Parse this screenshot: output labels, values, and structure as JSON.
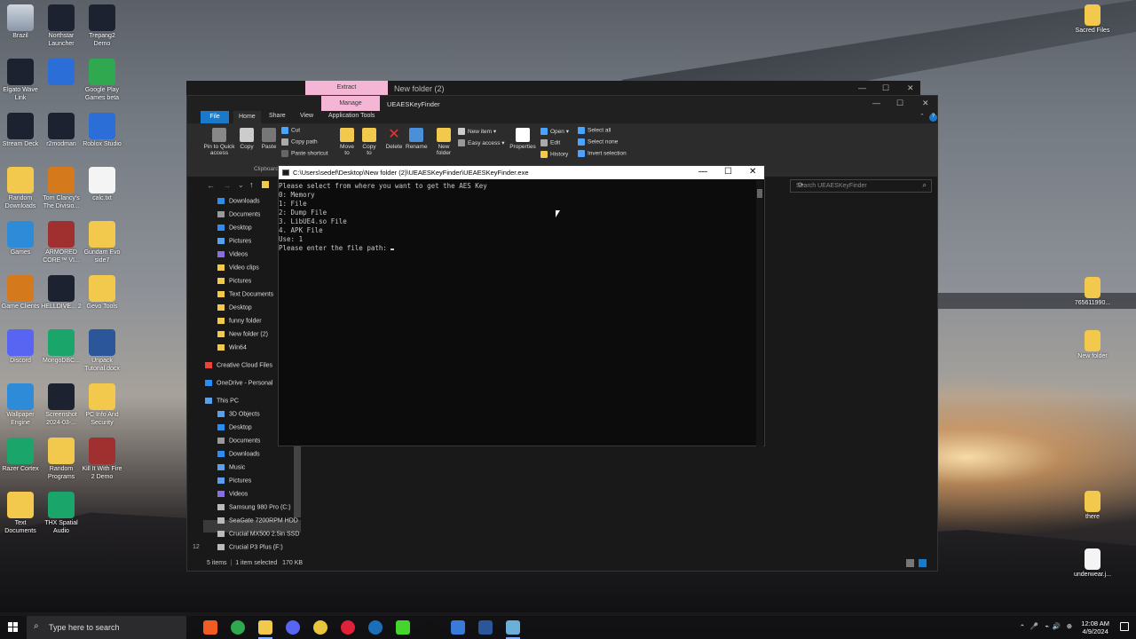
{
  "desktop": {
    "icons_left": [
      {
        "label": "Brazil",
        "icon": "recycle-bin-icon"
      },
      {
        "label": "Northstar Launcher",
        "icon": "northstar-icon"
      },
      {
        "label": "Trepang2 Demo",
        "icon": "trepang-icon"
      },
      {
        "label": "Elgato Wave Link",
        "icon": "wave-link-icon"
      },
      {
        "label": "",
        "icon": "app-icon"
      },
      {
        "label": "Google Play Games beta",
        "icon": "play-games-icon"
      },
      {
        "label": "Stream Deck",
        "icon": "stream-deck-icon"
      },
      {
        "label": "r2modman",
        "icon": "r2modman-icon"
      },
      {
        "label": "Roblox Studio",
        "icon": "roblox-icon"
      },
      {
        "label": "Random Downloads",
        "icon": "folder-icon"
      },
      {
        "label": "Tom Clancy's The Divisio...",
        "icon": "division-icon"
      },
      {
        "label": "calc.txt",
        "icon": "text-file-icon"
      },
      {
        "label": "Games",
        "icon": "games-icon"
      },
      {
        "label": "ARMORED CORE™ VI...",
        "icon": "armored-core-icon"
      },
      {
        "label": "Gundam Evo side7",
        "icon": "folder-icon"
      },
      {
        "label": "Game Clients",
        "icon": "game-clients-icon"
      },
      {
        "label": "HELLDIVE... 2",
        "icon": "helldivers-icon"
      },
      {
        "label": "Gevo Tools",
        "icon": "folder-icon"
      },
      {
        "label": "Discord",
        "icon": "discord-icon"
      },
      {
        "label": "MongoDBC...",
        "icon": "mongodb-icon"
      },
      {
        "label": "Unpack Tutorial.docx",
        "icon": "word-doc-icon"
      },
      {
        "label": "Wallpaper Engine",
        "icon": "wallpaper-engine-icon"
      },
      {
        "label": "Screenshot 2024-03-...",
        "icon": "screenshot-icon"
      },
      {
        "label": "PC Info And Security",
        "icon": "folder-icon"
      },
      {
        "label": "Razer Cortex",
        "icon": "razer-cortex-icon"
      },
      {
        "label": "Random Programs",
        "icon": "folder-icon"
      },
      {
        "label": "Kill It With Fire 2 Demo",
        "icon": "kill-it-with-fire-icon"
      },
      {
        "label": "Text Documents",
        "icon": "folder-icon"
      },
      {
        "label": "THX Spatial Audio",
        "icon": "thx-icon"
      }
    ],
    "icons_right": [
      {
        "label": "Sacred Files",
        "icon": "folder-icon"
      },
      {
        "label": "765611990...",
        "icon": "folder-icon"
      },
      {
        "label": "New folder",
        "icon": "folder-icon"
      },
      {
        "label": "there",
        "icon": "folder-icon"
      },
      {
        "label": "underwear.j...",
        "icon": "image-file-icon"
      }
    ]
  },
  "explorer_back": {
    "context_tab": "Extract",
    "title": "New folder (2)"
  },
  "explorer": {
    "context_tab": "Manage",
    "title": "UEAESKeyFinder",
    "tabs": [
      "File",
      "Home",
      "Share",
      "View",
      "Application Tools"
    ],
    "ribbon": {
      "pin_label": "Pin to Quick access",
      "copy_label": "Copy",
      "paste_label": "Paste",
      "cut_label": "Cut",
      "copy_path_label": "Copy path",
      "paste_shortcut_label": "Paste shortcut",
      "clipboard_group": "Clipboard",
      "move_to_label": "Move to",
      "copy_to_label": "Copy to",
      "delete_label": "Delete",
      "rename_label": "Rename",
      "new_folder_label": "New folder",
      "new_item_label": "New item",
      "easy_access_label": "Easy access",
      "properties_label": "Properties",
      "open_label": "Open",
      "edit_label": "Edit",
      "history_label": "History",
      "select_all_label": "Select all",
      "select_none_label": "Select none",
      "invert_selection_label": "Invert selection"
    },
    "search_placeholder": "Search UEAESKeyFinder",
    "nav_items": [
      {
        "label": "Downloads",
        "icon": "download-icon"
      },
      {
        "label": "Documents",
        "icon": "documents-icon"
      },
      {
        "label": "Desktop",
        "icon": "desktop-icon"
      },
      {
        "label": "Pictures",
        "icon": "pictures-icon"
      },
      {
        "label": "Videos",
        "icon": "videos-icon"
      },
      {
        "label": "Video clips",
        "icon": "folder-icon"
      },
      {
        "label": "Pictures",
        "icon": "folder-icon"
      },
      {
        "label": "Text Documents",
        "icon": "folder-icon"
      },
      {
        "label": "Desktop",
        "icon": "folder-icon"
      },
      {
        "label": "funny folder",
        "icon": "folder-icon"
      },
      {
        "label": "New folder (2)",
        "icon": "folder-icon"
      },
      {
        "label": "Win64",
        "icon": "folder-icon"
      },
      {
        "label": "Creative Cloud Files",
        "icon": "creative-cloud-icon"
      },
      {
        "label": "OneDrive - Personal",
        "icon": "onedrive-icon"
      },
      {
        "label": "This PC",
        "icon": "pc-icon"
      },
      {
        "label": "3D Objects",
        "icon": "3d-objects-icon"
      },
      {
        "label": "Desktop",
        "icon": "desktop-icon"
      },
      {
        "label": "Documents",
        "icon": "documents-icon"
      },
      {
        "label": "Downloads",
        "icon": "download-icon"
      },
      {
        "label": "Music",
        "icon": "music-icon"
      },
      {
        "label": "Pictures",
        "icon": "pictures-icon"
      },
      {
        "label": "Videos",
        "icon": "videos-icon"
      },
      {
        "label": "Samsung 980 Pro (C:)",
        "icon": "drive-icon"
      },
      {
        "label": "SeaGate 7200RPM HDD",
        "icon": "drive-icon"
      },
      {
        "label": "Crucial MX500 2.5in SSD",
        "icon": "drive-icon"
      },
      {
        "label": "Crucial P3 Plus (F:)",
        "icon": "drive-icon"
      }
    ],
    "status": {
      "items": "5 items",
      "selected": "1 item selected",
      "size": "170 KB"
    },
    "left_count": "12"
  },
  "console": {
    "title": "C:\\Users\\sedef\\Desktop\\New folder (2)\\UEAESKeyFinder\\UEAESKeyFinder.exe",
    "lines": [
      "Please select from where you want to get the AES Key",
      "0: Memory",
      "1: File",
      "2: Dump File",
      "3. LibUE4.so File",
      "4. APK File",
      "Use: 1",
      "Please enter the file path: "
    ]
  },
  "taskbar": {
    "search_placeholder": "Type here to search",
    "time": "12:08 AM",
    "date": "4/9/2024",
    "apps": [
      "brave-icon",
      "xbox-icon",
      "file-explorer-icon",
      "discord-icon",
      "chrome-icon",
      "opera-gx-icon",
      "steam-icon",
      "razer-icon",
      "wave-icon",
      "app-icon",
      "word-icon",
      "terminal-icon"
    ]
  }
}
